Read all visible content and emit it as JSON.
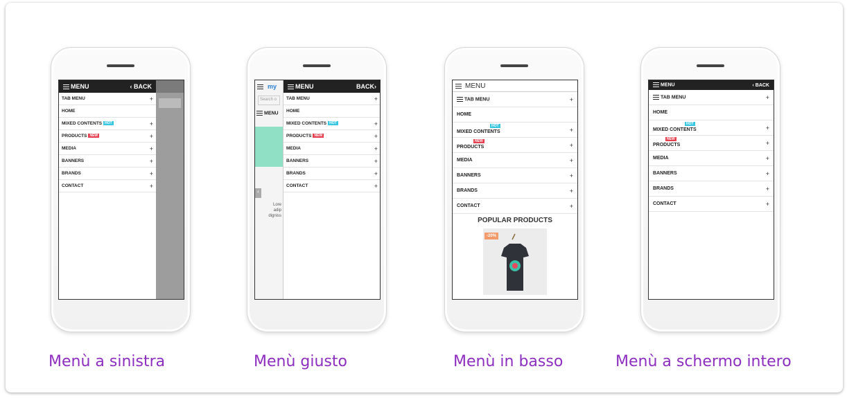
{
  "captions": [
    "Menù a sinistra",
    "Menù giusto",
    "Menù in basso",
    "Menù a schermo intero"
  ],
  "menu": {
    "title": "MENU",
    "back_label": "BACK",
    "back_chevron": "‹",
    "items": [
      {
        "label": "TAB MENU",
        "expand": "+"
      },
      {
        "label": "HOME",
        "expand": ""
      },
      {
        "label": "MIXED CONTENTS",
        "badge": "HOT",
        "expand": "+"
      },
      {
        "label": "PRODUCTS",
        "badge": "NEW",
        "expand": "+"
      },
      {
        "label": "MEDIA",
        "expand": "+"
      },
      {
        "label": "BANNERS",
        "expand": "+"
      },
      {
        "label": "BRANDS",
        "expand": "+"
      },
      {
        "label": "CONTACT",
        "expand": "+"
      }
    ]
  },
  "right_phone": {
    "logo_text": "my",
    "search_placeholder": "Search o",
    "side_menu_label": "MENU",
    "lorem_lines": [
      "Lore",
      "adip",
      "digniss"
    ]
  },
  "bottom_phone": {
    "popular_title": "POPULAR PRODUCTS",
    "discount": "-20%"
  },
  "colors": {
    "caption": "#8e2ec1",
    "hot_badge": "#39c6e0",
    "new_badge": "#e64050",
    "menu_bar": "#222222"
  }
}
